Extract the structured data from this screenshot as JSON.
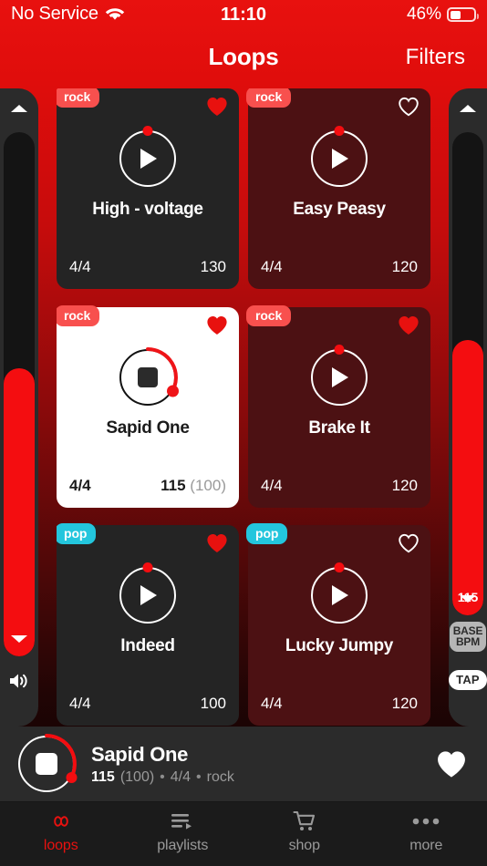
{
  "status_bar": {
    "carrier": "No Service",
    "wifi_icon": "wifi-icon",
    "time": "11:10",
    "battery_percent": "46%",
    "battery_level": 46
  },
  "nav": {
    "title": "Loops",
    "filters_label": "Filters"
  },
  "volume_rail": {
    "up_icon": "chevron-up-icon",
    "down_icon": "chevron-down-icon",
    "speaker_icon": "speaker-icon",
    "value_percent": 55
  },
  "bpm_rail": {
    "up_icon": "chevron-up-icon",
    "down_icon": "chevron-down-icon",
    "value": "115",
    "value_percent": 57,
    "base_bpm_label_line1": "BASE",
    "base_bpm_label_line2": "BPM",
    "tap_label": "TAP"
  },
  "loops": [
    {
      "title": "High - voltage",
      "tag": "rock",
      "tag_color": "#f8504e",
      "time_signature": "4/4",
      "bpm": "130",
      "base_bpm": "",
      "favorited": true,
      "playing": false,
      "card_style": "dark"
    },
    {
      "title": "Easy Peasy",
      "tag": "rock",
      "tag_color": "#f8504e",
      "time_signature": "4/4",
      "bpm": "120",
      "base_bpm": "",
      "favorited": false,
      "playing": false,
      "card_style": "maroon"
    },
    {
      "title": "Sapid One",
      "tag": "rock",
      "tag_color": "#f8504e",
      "time_signature": "4/4",
      "bpm": "115",
      "base_bpm": "(100)",
      "favorited": true,
      "playing": true,
      "card_style": "selected"
    },
    {
      "title": "Brake It",
      "tag": "rock",
      "tag_color": "#f8504e",
      "time_signature": "4/4",
      "bpm": "120",
      "base_bpm": "",
      "favorited": true,
      "playing": false,
      "card_style": "maroon"
    },
    {
      "title": "Indeed",
      "tag": "pop",
      "tag_color": "#23c6dd",
      "time_signature": "4/4",
      "bpm": "100",
      "base_bpm": "",
      "favorited": true,
      "playing": false,
      "card_style": "dark"
    },
    {
      "title": "Lucky Jumpy",
      "tag": "pop",
      "tag_color": "#23c6dd",
      "time_signature": "4/4",
      "bpm": "120",
      "base_bpm": "",
      "favorited": false,
      "playing": false,
      "card_style": "maroon"
    }
  ],
  "now_playing": {
    "title": "Sapid One",
    "bpm": "115",
    "base_bpm": "(100)",
    "separator_1": "•",
    "time_signature": "4/4",
    "separator_2": "•",
    "genre": "rock",
    "favorited": true,
    "stop_icon": "stop-icon"
  },
  "tabs": [
    {
      "label": "loops",
      "icon": "infinity-icon",
      "active": true
    },
    {
      "label": "playlists",
      "icon": "playlist-icon",
      "active": false
    },
    {
      "label": "shop",
      "icon": "cart-icon",
      "active": false
    },
    {
      "label": "more",
      "icon": "ellipsis-icon",
      "active": false
    }
  ],
  "colors": {
    "accent_red": "#e8110f",
    "slider_red": "#f40d10",
    "tag_rock": "#f8504e",
    "tag_pop": "#23c6dd",
    "card_dark": "#242424",
    "card_maroon": "#4c1113",
    "rail_bg": "#2b2b2b",
    "tabbar_bg": "#1b1b1b"
  }
}
